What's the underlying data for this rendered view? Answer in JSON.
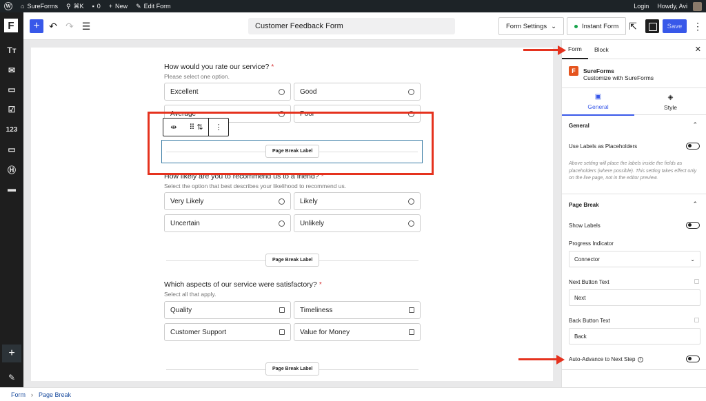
{
  "admin_bar": {
    "site_name": "SureForms",
    "shortcut": "⌘K",
    "comments_count": "0",
    "new_label": "New",
    "edit_label": "Edit Form",
    "login_label": "Login",
    "greeting": "Howdy, Avi"
  },
  "toolbar": {
    "form_title": "Customer Feedback Form",
    "form_settings_label": "Form Settings",
    "instant_form_label": "Instant Form",
    "save_label": "Save"
  },
  "left_sidebar": {
    "logo": "F",
    "number_icon_label": "123"
  },
  "form": {
    "q1": {
      "title": "How would you rate our service?",
      "required": "*",
      "help": "Please select one option.",
      "options": [
        "Excellent",
        "Good",
        "Average",
        "Poor"
      ]
    },
    "page_break_label": "Page Break Label",
    "q2": {
      "title": "How likely are you to recommend us to a friend?",
      "required": "*",
      "help": "Select the option that best describes your likelihood to recommend us.",
      "options": [
        "Very Likely",
        "Likely",
        "Uncertain",
        "Unlikely"
      ]
    },
    "q3": {
      "title": "Which aspects of our service were satisfactory?",
      "required": "*",
      "help": "Select all that apply.",
      "options": [
        "Quality",
        "Timeliness",
        "Customer Support",
        "Value for Money"
      ]
    }
  },
  "sidebar": {
    "tab_form": "Form",
    "tab_block": "Block",
    "plugin_name": "SureForms",
    "plugin_sub": "Customize with SureForms",
    "tab_general": "General",
    "tab_style": "Style",
    "general_heading": "General",
    "use_labels_label": "Use Labels as Placeholders",
    "note": "Above setting will place the labels inside the fields as placeholders (where possible). This setting takes effect only on the live page, not in the editor preview.",
    "page_break_heading": "Page Break",
    "show_labels_label": "Show Labels",
    "progress_indicator_label": "Progress Indicator",
    "progress_indicator_value": "Connector",
    "next_button_label": "Next Button Text",
    "next_button_value": "Next",
    "back_button_label": "Back Button Text",
    "back_button_value": "Back",
    "auto_advance_label": "Auto-Advance to Next Step"
  },
  "footer": {
    "crumb_form": "Form",
    "separator": "›",
    "crumb_block": "Page Break"
  },
  "colors": {
    "accent": "#3858e9",
    "annotation": "#e5321e",
    "brand": "#e5541e"
  }
}
